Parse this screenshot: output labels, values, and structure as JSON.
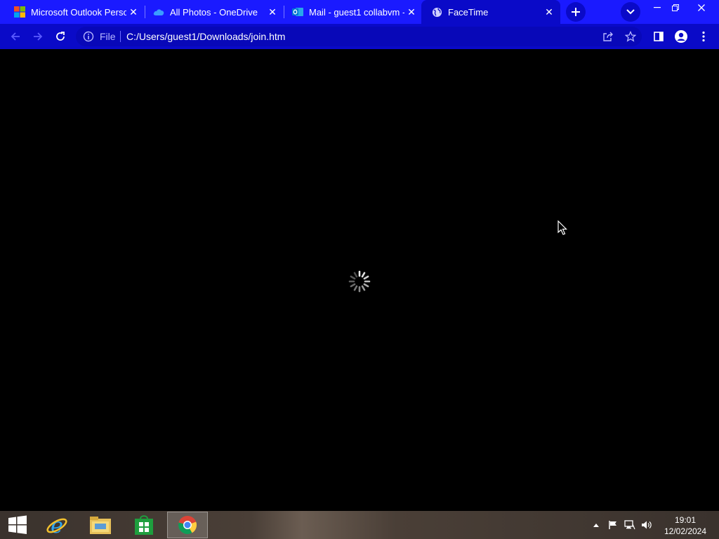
{
  "browser": {
    "tabs": [
      {
        "title": "Microsoft Outlook Person",
        "icon": "microsoft-logo-icon",
        "active": false
      },
      {
        "title": "All Photos - OneDrive",
        "icon": "onedrive-icon",
        "active": false
      },
      {
        "title": "Mail - guest1 collabvm -",
        "icon": "outlook-icon",
        "active": false
      },
      {
        "title": "FaceTime",
        "icon": "globe-icon",
        "active": true
      }
    ],
    "omnibox": {
      "scheme_label": "File",
      "url": "C:/Users/guest1/Downloads/join.htm"
    }
  },
  "page": {
    "state": "loading"
  },
  "taskbar": {
    "apps": [
      "start",
      "internet-explorer",
      "file-explorer",
      "store",
      "chrome"
    ],
    "clock": {
      "time": "19:01",
      "date": "12/02/2024"
    }
  },
  "colors": {
    "tabstrip": "#1a1aff",
    "toolbar": "#0a0ac8",
    "page_background": "#000000"
  }
}
